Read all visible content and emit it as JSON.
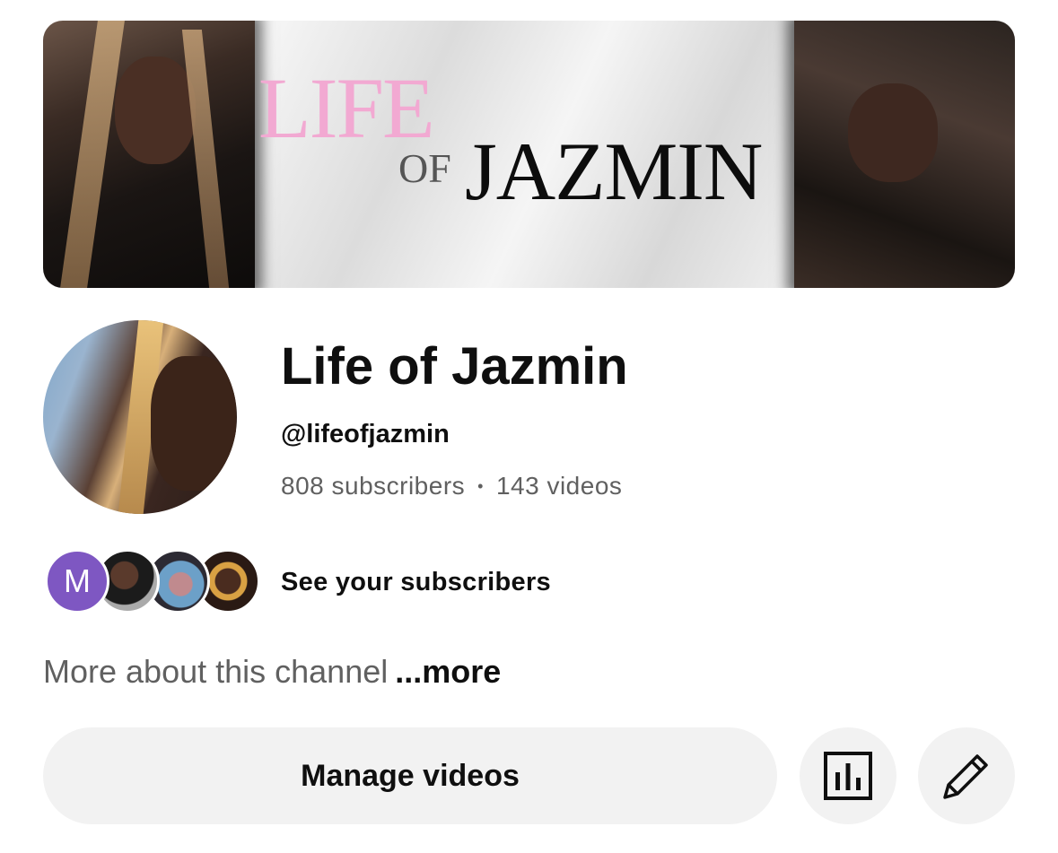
{
  "banner": {
    "title_line1": "LIFE",
    "title_of": "OF",
    "title_line2": "JAZMIN"
  },
  "channel": {
    "name": "Life of Jazmin",
    "handle": "@lifeofjazmin",
    "subscribers": "808 subscribers",
    "separator": "•",
    "videos": "143 videos"
  },
  "subscribers_preview": {
    "first_initial": "M",
    "first_avatar_color": "#7e57c2",
    "label": "See your subscribers"
  },
  "about": {
    "text": "More about this channel",
    "more_label": "...more"
  },
  "actions": {
    "manage_label": "Manage videos",
    "analytics_icon": "bar-chart-icon",
    "edit_icon": "pencil-icon"
  }
}
